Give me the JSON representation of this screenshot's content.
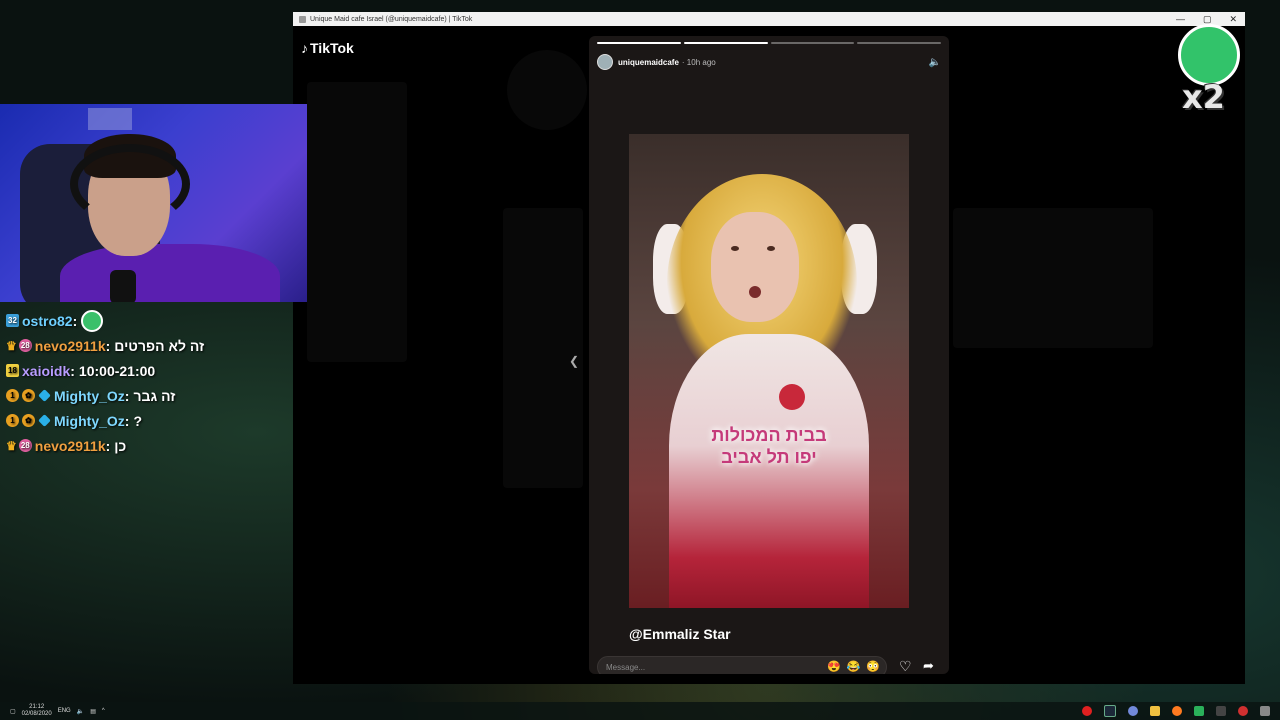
{
  "window": {
    "title": "Unique Maid cafe Israel (@uniquemaidcafe) | TikTok",
    "controls": [
      "—",
      "▢",
      "✕"
    ]
  },
  "tiktok": {
    "logo": "TikTok"
  },
  "story": {
    "username": "uniquemaidcafe",
    "time": "· 10h ago",
    "overlay_lines": [
      "בבית המכולות",
      "יפו תל אביב"
    ],
    "mention": "@Emmaliz Star",
    "message_placeholder": "Message...",
    "progress_done": 2,
    "progress_total": 4,
    "emoji_reactions": [
      "😍",
      "😂",
      "😳"
    ]
  },
  "chat": [
    {
      "badges": [
        "32"
      ],
      "badge_types": [
        "lvl"
      ],
      "user": "ostro82",
      "user_color": "#6fd0ff",
      "message": "",
      "emote": true
    },
    {
      "badges": [
        "crown",
        "28"
      ],
      "badge_types": [
        "crown",
        "pink"
      ],
      "user": "nevo2911k",
      "user_color": "#f0a040",
      "message": "זה לא הפרטים",
      "emote": false
    },
    {
      "badges": [
        "18"
      ],
      "badge_types": [
        "yellow"
      ],
      "user": "xaioidk",
      "user_color": "#b89cff",
      "message": "10:00-21:00",
      "emote": false
    },
    {
      "badges": [
        "1",
        "g",
        "b"
      ],
      "badge_types": [
        "gold",
        "gold",
        "blue"
      ],
      "user": "Mighty_Oz",
      "user_color": "#7fd8ff",
      "message": "זה גבר",
      "emote": false
    },
    {
      "badges": [
        "1",
        "g",
        "b"
      ],
      "badge_types": [
        "gold",
        "gold",
        "blue"
      ],
      "user": "Mighty_Oz",
      "user_color": "#7fd8ff",
      "message": "?",
      "emote": false
    },
    {
      "badges": [
        "crown",
        "28"
      ],
      "badge_types": [
        "crown",
        "pink"
      ],
      "user": "nevo2911k",
      "user_color": "#f0a040",
      "message": "כן",
      "emote": false
    }
  ],
  "overlay_emote": {
    "label": "x2"
  },
  "taskbar": {
    "time": "21:12",
    "date": "02/08/2020",
    "lang": "ENG"
  }
}
